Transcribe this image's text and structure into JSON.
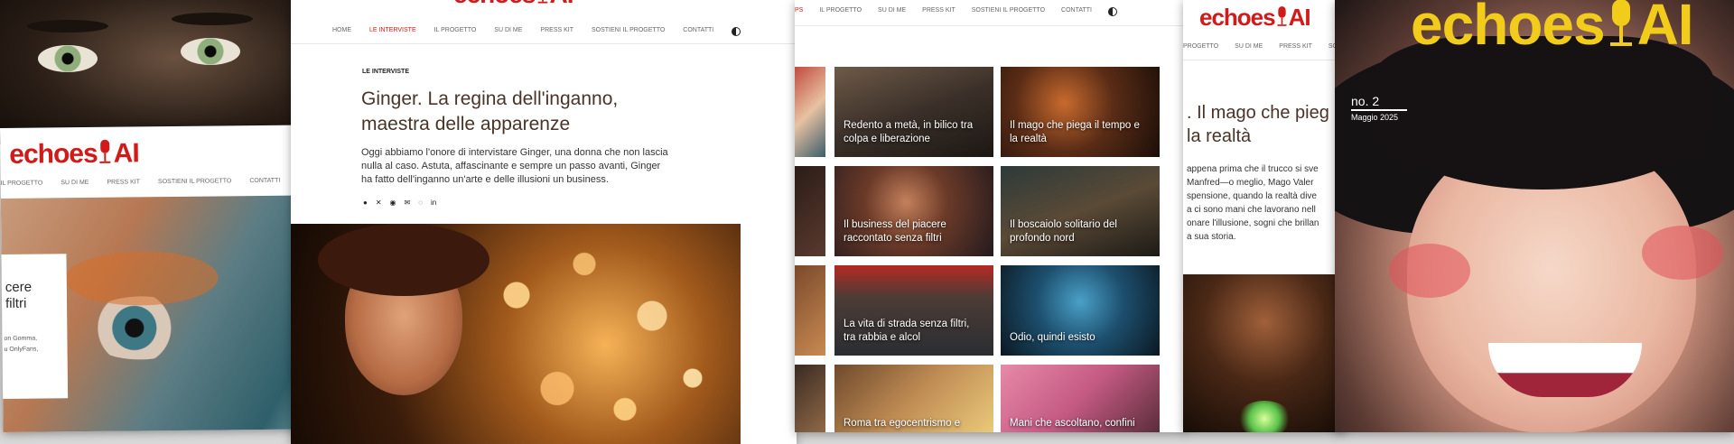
{
  "brand": {
    "logo_word": "echoes",
    "logo_suffix": "AI",
    "accent": "#d11a1a",
    "magazine_yellow": "#f2cc1b"
  },
  "article": {
    "nav": [
      "HOME",
      "LE INTERVISTE",
      "IL PROGETTO",
      "SU DI ME",
      "PRESS KIT",
      "SOSTIENI IL PROGETTO",
      "CONTATTI"
    ],
    "nav_active": "LE INTERVISTE",
    "category": "LE INTERVISTE",
    "title_line1": "Ginger. La regina dell'inganno,",
    "title_line2": "maestra delle apparenze",
    "intro_line1": "Oggi abbiamo l'onore di intervistare Ginger, una donna che non lascia",
    "intro_line2": "nulla al caso. Astuta, affascinante e sempre un passo avanti, Ginger",
    "intro_line3": "ha fatto dell'inganno un'arte e delle illusioni un business."
  },
  "left_panel": {
    "nav": [
      "IL PROGETTO",
      "SU DI ME",
      "PRESS KIT",
      "SOSTIENI IL PROGETTO",
      "CONTATTI"
    ],
    "card_line1": "cere",
    "card_line2": "filtri",
    "card_small1": "on Gomma,",
    "card_small2": "u OnlyFans,"
  },
  "grid": {
    "nav": [
      "PS",
      "IL PROGETTO",
      "SU DI ME",
      "PRESS KIT",
      "SOSTIENI IL PROGETTO",
      "CONTATTI"
    ],
    "tiles": [
      {
        "caption1": "Redento a metà, in bilico tra",
        "caption2": "colpa e liberazione"
      },
      {
        "caption1": "Il mago che piega il tempo e",
        "caption2": "la realtà"
      },
      {
        "caption1": "Il business del piacere",
        "caption2": "raccontato senza filtri"
      },
      {
        "caption1": "Il boscaiolo solitario del",
        "caption2": "profondo nord"
      },
      {
        "caption1": "La vita di strada senza filtri,",
        "caption2": "tra rabbia e alcol"
      },
      {
        "caption1": "Odio, quindi esisto",
        "caption2": ""
      },
      {
        "caption1": "Roma tra egocentrismo e",
        "caption2": ""
      },
      {
        "caption1": "Mani che ascoltano, confini",
        "caption2": ""
      }
    ]
  },
  "mago": {
    "nav": [
      "PROGETTO",
      "SU DI ME",
      "PRESS KIT",
      "SO"
    ],
    "title_line1": ". Il mago che pieg",
    "title_line2": "la realtà",
    "body": [
      "appena prima che il trucco si sve",
      "Manfred—o meglio, Mago Valer",
      "spensione, quando la realtà dive",
      "a ci sono mani che lavorano nell",
      "onare l'illusione, sogni che brillan",
      "a sua storia."
    ]
  },
  "magazine": {
    "issue": "no. 2",
    "date": "Maggio 2025"
  }
}
